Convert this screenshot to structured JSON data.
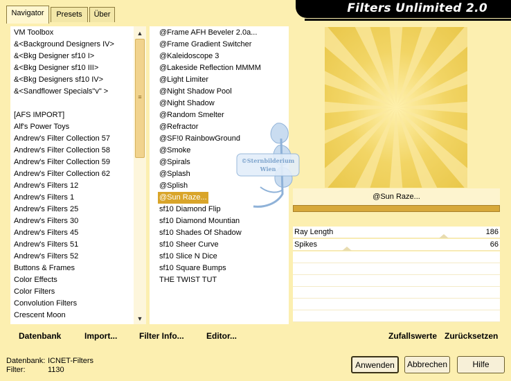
{
  "tabs": [
    {
      "label": "Navigator"
    },
    {
      "label": "Presets"
    },
    {
      "label": "Über"
    }
  ],
  "app_title": "Filters Unlimited 2.0",
  "categories": [
    "VM Toolbox",
    "&<Background Designers IV>",
    "&<Bkg Designer sf10 I>",
    "&<Bkg Designer sf10 III>",
    "&<Bkg Designers sf10 IV>",
    "&<Sandflower Specials\"v\" >",
    "",
    "[AFS IMPORT]",
    "Alf's Power Toys",
    "Andrew's Filter Collection 57",
    "Andrew's Filter Collection 58",
    "Andrew's Filter Collection 59",
    "Andrew's Filter Collection 62",
    "Andrew's Filters 12",
    "Andrew's Filters 1",
    "Andrew's Filters 25",
    "Andrew's Filters 30",
    "Andrew's Filters 45",
    "Andrew's Filters 51",
    "Andrew's Filters 52",
    "Buttons & Frames",
    "Color Effects",
    "Color Filters",
    "Convolution Filters",
    "Crescent Moon"
  ],
  "selected_category_index": 1,
  "filters": [
    "@Frame AFH Beveler 2.0a...",
    "@Frame Gradient Switcher",
    "@Kaleidoscope 3",
    "@Lakeside Reflection MMMM",
    "@Light Limiter",
    "@Night Shadow Pool",
    "@Night Shadow",
    "@Random Smelter",
    "@Refractor",
    "@SF!0 RainbowGround",
    "@Smoke",
    "@Spirals",
    "@Splash",
    "@Splish",
    "@Sun Raze...",
    "sf10 Diamond Flip",
    "sf10 Diamond Mountian",
    "sf10 Shades Of Shadow",
    "sf10 Sheer Curve",
    "sf10 Slice N Dice",
    "sf10 Square Bumps",
    "THE TWIST TUT"
  ],
  "selected_filter_index": 14,
  "watermark": {
    "line1": "©Sternbilderium",
    "line2": "Wien"
  },
  "preview": {
    "filter_name": "@Sun Raze..."
  },
  "params": [
    {
      "label": "Ray Length",
      "value": "186",
      "level": 0.73
    },
    {
      "label": "Spikes",
      "value": "66",
      "level": 0.26
    }
  ],
  "bottom_buttons": {
    "datenbank": "Datenbank",
    "import": "Import...",
    "filter_info": "Filter Info...",
    "editor": "Editor...",
    "zufallswerte": "Zufallswerte",
    "zuruecksetzen": "Zurücksetzen"
  },
  "status": {
    "datenbank_label": "Datenbank:",
    "datenbank_value": "ICNET-Filters",
    "filter_label": "Filter:",
    "filter_value": "1130"
  },
  "dialog_buttons": {
    "apply": "Anwenden",
    "cancel": "Abbrechen",
    "help": "Hilfe"
  },
  "colors": {
    "background": "#fcefb0",
    "accent": "#d9a52a",
    "title_bg": "#000000"
  }
}
